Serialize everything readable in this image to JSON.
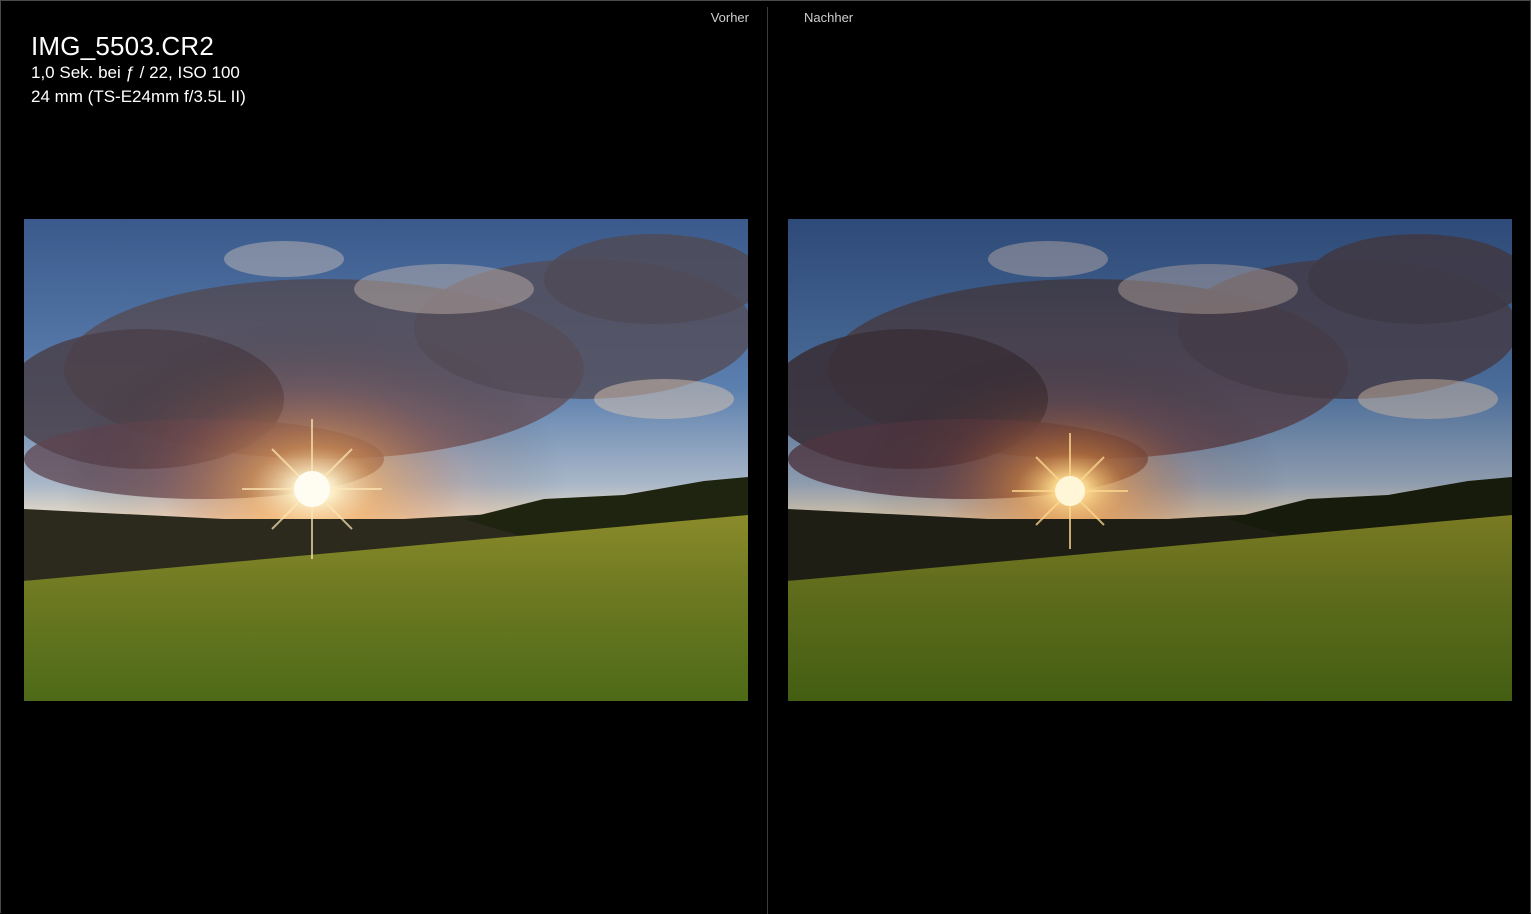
{
  "panes": {
    "before_label": "Vorher",
    "after_label": "Nachher"
  },
  "info": {
    "filename": "IMG_5503.CR2",
    "exposure": "1,0 Sek. bei ƒ / 22, ISO 100",
    "lens": "24 mm (TS-E24mm f/3.5L II)"
  },
  "colors": {
    "background": "#000000",
    "label_text": "#cfcfcf",
    "info_text": "#ffffff",
    "divider": "#3c3c3c"
  }
}
